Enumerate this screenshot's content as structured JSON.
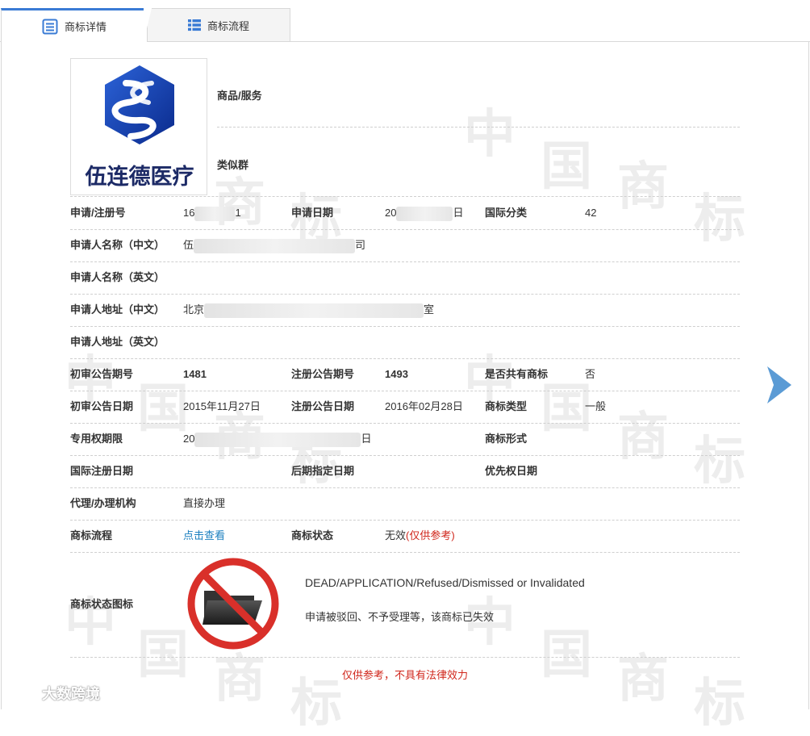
{
  "tabs": {
    "details_label": "商标详情",
    "flow_label": "商标流程"
  },
  "logo": {
    "text": "伍连德医疗"
  },
  "side": {
    "goods_services_label": "商品/服务",
    "similar_group_label": "类似群"
  },
  "rows": {
    "reg_no_label": "申请/注册号",
    "reg_no_start": "16",
    "reg_no_end": "1",
    "apply_date_label": "申请日期",
    "apply_date_start": "20",
    "apply_date_end": "日",
    "intl_class_label": "国际分类",
    "intl_class_value": "42",
    "applicant_cn_label": "申请人名称（中文）",
    "applicant_cn_start": "伍",
    "applicant_cn_end": "司",
    "applicant_en_label": "申请人名称（英文）",
    "address_cn_label": "申请人地址（中文）",
    "address_cn_start": "北京",
    "address_cn_end": "室",
    "address_en_label": "申请人地址（英文）",
    "prelim_issue_label": "初审公告期号",
    "prelim_issue_value": "1481",
    "reg_issue_label": "注册公告期号",
    "reg_issue_value": "1493",
    "shared_mark_label": "是否共有商标",
    "shared_mark_value": "否",
    "prelim_date_label": "初审公告日期",
    "prelim_date_value": "2015年11月27日",
    "reg_date_label": "注册公告日期",
    "reg_date_value": "2016年02月28日",
    "mark_type_label": "商标类型",
    "mark_type_value": "一般",
    "exclusive_period_label": "专用权期限",
    "exclusive_period_start": "20",
    "exclusive_period_end": "日",
    "mark_form_label": "商标形式",
    "intl_reg_date_label": "国际注册日期",
    "later_designation_label": "后期指定日期",
    "priority_date_label": "优先权日期",
    "agent_label": "代理/办理机构",
    "agent_value": "直接办理",
    "flow_label": "商标流程",
    "flow_link": "点击查看",
    "status_label": "商标状态",
    "status_value": "无效",
    "status_note": "(仅供参考)"
  },
  "status_icon": {
    "label": "商标状态图标",
    "english": "DEAD/APPLICATION/Refused/Dismissed or Invalidated",
    "chinese": "申请被驳回、不予受理等，该商标已失效",
    "icon": "folder-prohibited-icon"
  },
  "disclaimer": "仅供参考，不具有法律效力",
  "brand_watermark": "大数跨境",
  "colors": {
    "accent": "#3a7bd5",
    "link": "#1a7fbf",
    "warning": "#d0261b",
    "arrow": "#5b9bd5"
  }
}
